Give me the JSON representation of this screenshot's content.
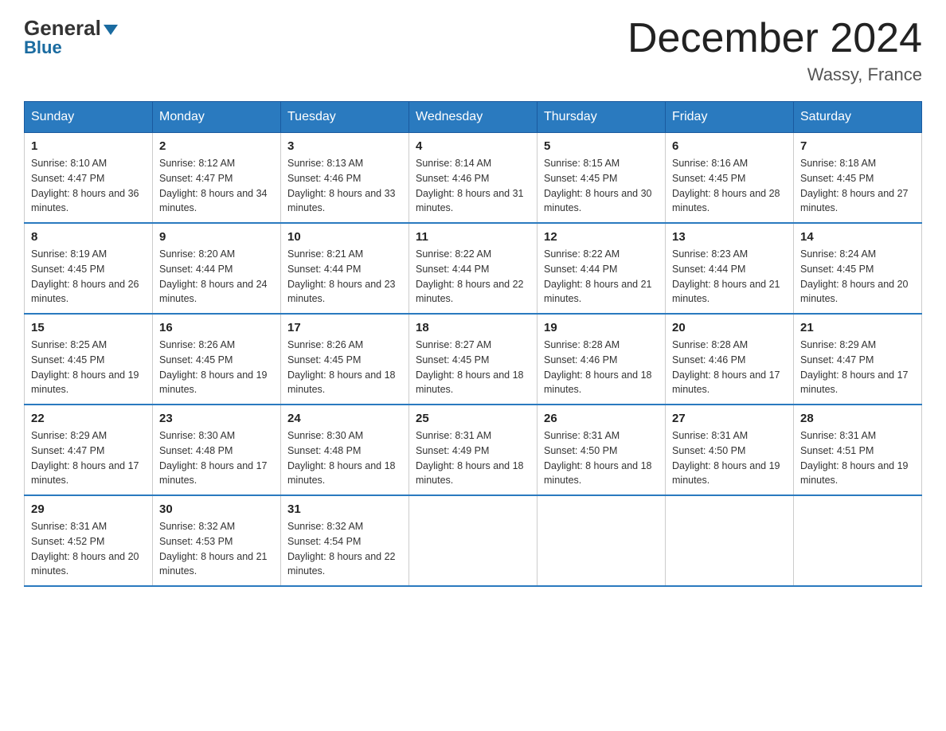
{
  "header": {
    "logo_general": "General",
    "logo_blue": "Blue",
    "month_title": "December 2024",
    "location": "Wassy, France"
  },
  "days_of_week": [
    "Sunday",
    "Monday",
    "Tuesday",
    "Wednesday",
    "Thursday",
    "Friday",
    "Saturday"
  ],
  "weeks": [
    [
      {
        "day": "1",
        "sunrise": "8:10 AM",
        "sunset": "4:47 PM",
        "daylight": "8 hours and 36 minutes."
      },
      {
        "day": "2",
        "sunrise": "8:12 AM",
        "sunset": "4:47 PM",
        "daylight": "8 hours and 34 minutes."
      },
      {
        "day": "3",
        "sunrise": "8:13 AM",
        "sunset": "4:46 PM",
        "daylight": "8 hours and 33 minutes."
      },
      {
        "day": "4",
        "sunrise": "8:14 AM",
        "sunset": "4:46 PM",
        "daylight": "8 hours and 31 minutes."
      },
      {
        "day": "5",
        "sunrise": "8:15 AM",
        "sunset": "4:45 PM",
        "daylight": "8 hours and 30 minutes."
      },
      {
        "day": "6",
        "sunrise": "8:16 AM",
        "sunset": "4:45 PM",
        "daylight": "8 hours and 28 minutes."
      },
      {
        "day": "7",
        "sunrise": "8:18 AM",
        "sunset": "4:45 PM",
        "daylight": "8 hours and 27 minutes."
      }
    ],
    [
      {
        "day": "8",
        "sunrise": "8:19 AM",
        "sunset": "4:45 PM",
        "daylight": "8 hours and 26 minutes."
      },
      {
        "day": "9",
        "sunrise": "8:20 AM",
        "sunset": "4:44 PM",
        "daylight": "8 hours and 24 minutes."
      },
      {
        "day": "10",
        "sunrise": "8:21 AM",
        "sunset": "4:44 PM",
        "daylight": "8 hours and 23 minutes."
      },
      {
        "day": "11",
        "sunrise": "8:22 AM",
        "sunset": "4:44 PM",
        "daylight": "8 hours and 22 minutes."
      },
      {
        "day": "12",
        "sunrise": "8:22 AM",
        "sunset": "4:44 PM",
        "daylight": "8 hours and 21 minutes."
      },
      {
        "day": "13",
        "sunrise": "8:23 AM",
        "sunset": "4:44 PM",
        "daylight": "8 hours and 21 minutes."
      },
      {
        "day": "14",
        "sunrise": "8:24 AM",
        "sunset": "4:45 PM",
        "daylight": "8 hours and 20 minutes."
      }
    ],
    [
      {
        "day": "15",
        "sunrise": "8:25 AM",
        "sunset": "4:45 PM",
        "daylight": "8 hours and 19 minutes."
      },
      {
        "day": "16",
        "sunrise": "8:26 AM",
        "sunset": "4:45 PM",
        "daylight": "8 hours and 19 minutes."
      },
      {
        "day": "17",
        "sunrise": "8:26 AM",
        "sunset": "4:45 PM",
        "daylight": "8 hours and 18 minutes."
      },
      {
        "day": "18",
        "sunrise": "8:27 AM",
        "sunset": "4:45 PM",
        "daylight": "8 hours and 18 minutes."
      },
      {
        "day": "19",
        "sunrise": "8:28 AM",
        "sunset": "4:46 PM",
        "daylight": "8 hours and 18 minutes."
      },
      {
        "day": "20",
        "sunrise": "8:28 AM",
        "sunset": "4:46 PM",
        "daylight": "8 hours and 17 minutes."
      },
      {
        "day": "21",
        "sunrise": "8:29 AM",
        "sunset": "4:47 PM",
        "daylight": "8 hours and 17 minutes."
      }
    ],
    [
      {
        "day": "22",
        "sunrise": "8:29 AM",
        "sunset": "4:47 PM",
        "daylight": "8 hours and 17 minutes."
      },
      {
        "day": "23",
        "sunrise": "8:30 AM",
        "sunset": "4:48 PM",
        "daylight": "8 hours and 17 minutes."
      },
      {
        "day": "24",
        "sunrise": "8:30 AM",
        "sunset": "4:48 PM",
        "daylight": "8 hours and 18 minutes."
      },
      {
        "day": "25",
        "sunrise": "8:31 AM",
        "sunset": "4:49 PM",
        "daylight": "8 hours and 18 minutes."
      },
      {
        "day": "26",
        "sunrise": "8:31 AM",
        "sunset": "4:50 PM",
        "daylight": "8 hours and 18 minutes."
      },
      {
        "day": "27",
        "sunrise": "8:31 AM",
        "sunset": "4:50 PM",
        "daylight": "8 hours and 19 minutes."
      },
      {
        "day": "28",
        "sunrise": "8:31 AM",
        "sunset": "4:51 PM",
        "daylight": "8 hours and 19 minutes."
      }
    ],
    [
      {
        "day": "29",
        "sunrise": "8:31 AM",
        "sunset": "4:52 PM",
        "daylight": "8 hours and 20 minutes."
      },
      {
        "day": "30",
        "sunrise": "8:32 AM",
        "sunset": "4:53 PM",
        "daylight": "8 hours and 21 minutes."
      },
      {
        "day": "31",
        "sunrise": "8:32 AM",
        "sunset": "4:54 PM",
        "daylight": "8 hours and 22 minutes."
      },
      null,
      null,
      null,
      null
    ]
  ]
}
